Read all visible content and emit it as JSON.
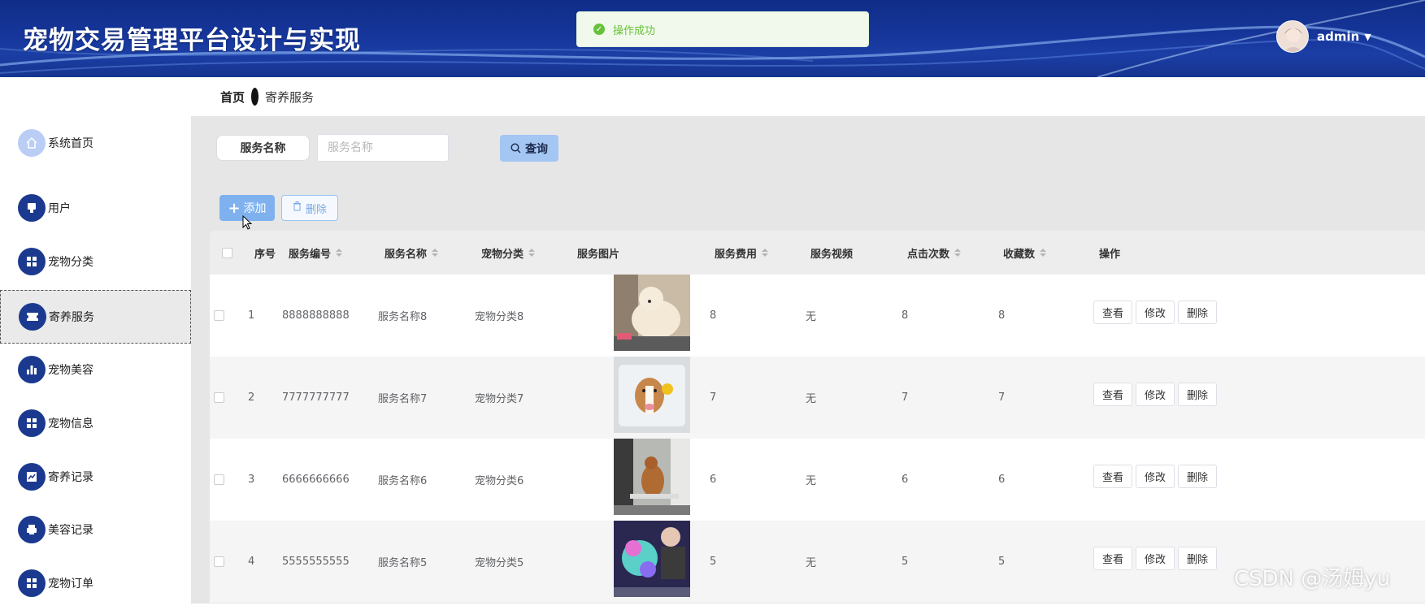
{
  "app": {
    "title": "宠物交易管理平台设计与实现"
  },
  "user": {
    "name": "admin"
  },
  "toast": {
    "message": "操作成功"
  },
  "sidebar": {
    "items": [
      {
        "label": "系统首页",
        "icon": "home-icon"
      },
      {
        "label": "用户",
        "icon": "user-icon"
      },
      {
        "label": "宠物分类",
        "icon": "grid-icon"
      },
      {
        "label": "寄养服务",
        "icon": "ticket-icon",
        "active": true
      },
      {
        "label": "宠物美容",
        "icon": "bar-chart-icon"
      },
      {
        "label": "宠物信息",
        "icon": "grid-icon"
      },
      {
        "label": "寄养记录",
        "icon": "line-chart-icon"
      },
      {
        "label": "美容记录",
        "icon": "printer-icon"
      },
      {
        "label": "宠物订单",
        "icon": "grid-icon"
      }
    ]
  },
  "breadcrumb": {
    "home": "首页",
    "current": "寄养服务"
  },
  "search": {
    "label": "服务名称",
    "placeholder": "服务名称",
    "button": "查询"
  },
  "toolbar": {
    "add": "添加",
    "delete": "删除"
  },
  "table": {
    "headers": {
      "index": "序号",
      "code": "服务编号",
      "name": "服务名称",
      "category": "宠物分类",
      "image": "服务图片",
      "fee": "服务费用",
      "video": "服务视频",
      "clicks": "点击次数",
      "favorites": "收藏数",
      "actions": "操作"
    },
    "rows": [
      {
        "index": "1",
        "code": "8888888888",
        "name": "服务名称8",
        "category": "宠物分类8",
        "fee": "8",
        "video": "无",
        "clicks": "8",
        "favorites": "8"
      },
      {
        "index": "2",
        "code": "7777777777",
        "name": "服务名称7",
        "category": "宠物分类7",
        "fee": "7",
        "video": "无",
        "clicks": "7",
        "favorites": "7"
      },
      {
        "index": "3",
        "code": "6666666666",
        "name": "服务名称6",
        "category": "宠物分类6",
        "fee": "6",
        "video": "无",
        "clicks": "6",
        "favorites": "6"
      },
      {
        "index": "4",
        "code": "5555555555",
        "name": "服务名称5",
        "category": "宠物分类5",
        "fee": "5",
        "video": "无",
        "clicks": "5",
        "favorites": "5"
      }
    ],
    "row_actions": {
      "view": "查看",
      "edit": "修改",
      "delete": "删除"
    }
  },
  "watermark": "CSDN @汤姆yu"
}
